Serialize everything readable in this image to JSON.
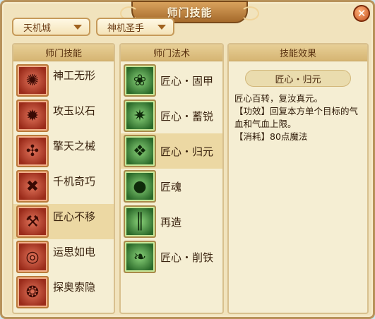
{
  "window": {
    "title": "师门技能",
    "close_glyph": "✕"
  },
  "dropdowns": {
    "sect": {
      "value": "天机城"
    },
    "school": {
      "value": "神机圣手"
    }
  },
  "skills_panel": {
    "header": "师门技能",
    "items": [
      {
        "label": "神工无形",
        "icon": "swirl-skill-icon",
        "glyph": "✺"
      },
      {
        "label": "攻玉以石",
        "icon": "mechanism-skill-icon",
        "glyph": "✹"
      },
      {
        "label": "擎天之械",
        "icon": "windmill-skill-icon",
        "glyph": "✣"
      },
      {
        "label": "千机奇巧",
        "icon": "cross-skill-icon",
        "glyph": "✖"
      },
      {
        "label": "匠心不移",
        "icon": "hammer-skill-icon",
        "glyph": "⚒"
      },
      {
        "label": "运思如电",
        "icon": "vortex-skill-icon",
        "glyph": "◎"
      },
      {
        "label": "探奥索隐",
        "icon": "spiral-skill-icon",
        "glyph": "❂"
      }
    ],
    "selected_index": 4
  },
  "spells_panel": {
    "header": "师门法术",
    "items": [
      {
        "label": "匠心・固甲",
        "icon": "shield-spell-icon",
        "glyph": "❀"
      },
      {
        "label": "匠心・蓄锐",
        "icon": "burst-spell-icon",
        "glyph": "✷"
      },
      {
        "label": "匠心・归元",
        "icon": "restore-spell-icon",
        "glyph": "❖"
      },
      {
        "label": "匠魂",
        "icon": "soul-spell-icon",
        "glyph": "●"
      },
      {
        "label": "再造",
        "icon": "rebuild-spell-icon",
        "glyph": "║"
      },
      {
        "label": "匠心・削铁",
        "icon": "blade-spell-icon",
        "glyph": "❧"
      }
    ],
    "selected_index": 2
  },
  "effect_panel": {
    "header": "技能效果",
    "name": "匠心・归元",
    "lines": [
      "匠心百转，复汝真元。",
      "【功效】回复本方单个目标的气血和气血上限。",
      "【消耗】80点魔法"
    ]
  },
  "colors": {
    "frame": "#b8925a",
    "parchment": "#f1e3bd",
    "selected_row": "#ecd8a3",
    "text_dark": "#3b2410"
  }
}
